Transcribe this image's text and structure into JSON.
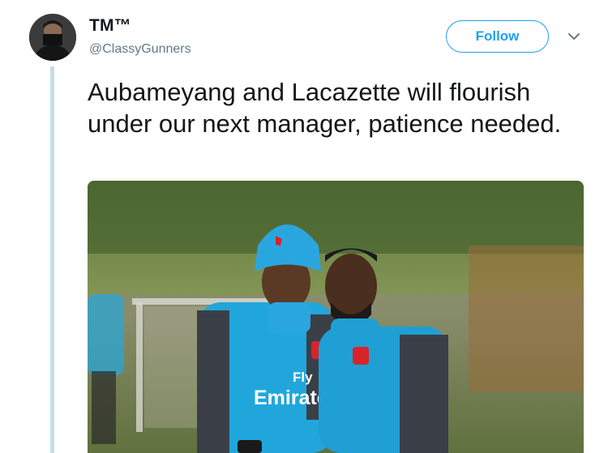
{
  "user": {
    "display_name": "TM™",
    "handle": "@ClassyGunners"
  },
  "actions": {
    "follow_label": "Follow"
  },
  "tweet": {
    "text": "Aubameyang and Lacazette will flourish under our next manager, patience needed."
  },
  "media": {
    "shirt_sponsor_line1": "Fly",
    "shirt_sponsor_line2": "Emirates"
  },
  "colors": {
    "accent": "#1da1f2",
    "secondary_text": "#657786",
    "thread_line": "#c4dde8"
  },
  "icons": {
    "menu": "chevron-down-icon"
  }
}
